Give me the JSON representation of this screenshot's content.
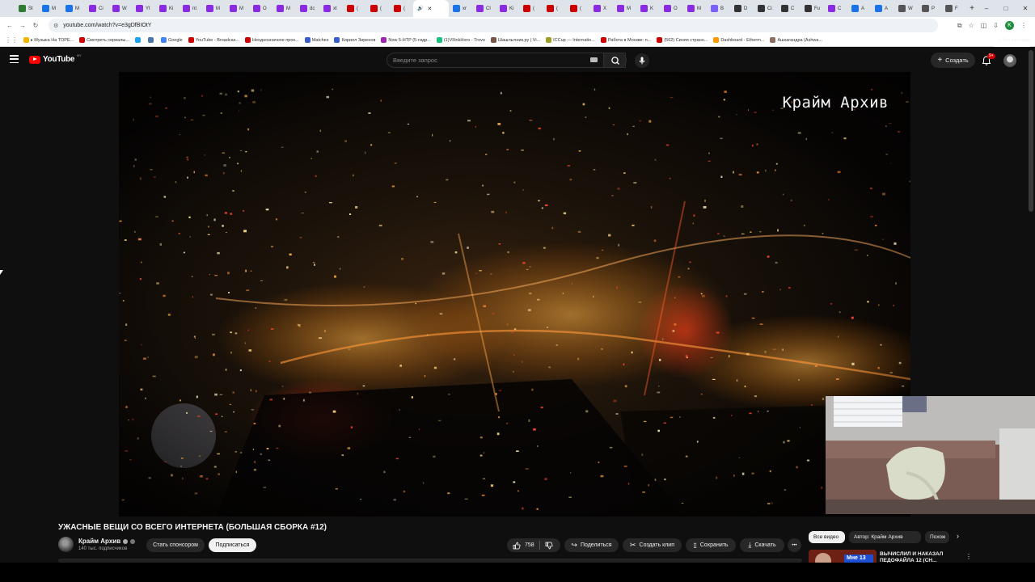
{
  "browser": {
    "tab_count_label": "",
    "active_tab_close": "✕",
    "new_tab": "+",
    "window_controls": {
      "minimize": "–",
      "maximize": "□",
      "close": "✕"
    },
    "tabs": [
      {
        "label": "St",
        "color": "#2e7d32"
      },
      {
        "label": "M",
        "color": "#1a73e8"
      },
      {
        "label": "M",
        "color": "#1a73e8"
      },
      {
        "label": "Ci",
        "color": "#8a2be2"
      },
      {
        "label": "W",
        "color": "#8a2be2"
      },
      {
        "label": "Yt",
        "color": "#8a2be2"
      },
      {
        "label": "Ki",
        "color": "#8a2be2"
      },
      {
        "label": "nt",
        "color": "#8a2be2"
      },
      {
        "label": "M",
        "color": "#8a2be2"
      },
      {
        "label": "M",
        "color": "#8a2be2"
      },
      {
        "label": "O",
        "color": "#8a2be2"
      },
      {
        "label": "M",
        "color": "#8a2be2"
      },
      {
        "label": "dc",
        "color": "#8a2be2"
      },
      {
        "label": "xt",
        "color": "#8a2be2"
      },
      {
        "label": "(",
        "color": "#cc0000"
      },
      {
        "label": "(",
        "color": "#cc0000"
      },
      {
        "label": "(",
        "color": "#cc0000"
      }
    ],
    "tabs_after": [
      {
        "label": "xr",
        "color": "#1a73e8"
      },
      {
        "label": "Cl",
        "color": "#8a2be2"
      },
      {
        "label": "Ki",
        "color": "#8a2be2"
      },
      {
        "label": "(",
        "color": "#cc0000"
      },
      {
        "label": "(",
        "color": "#cc0000"
      },
      {
        "label": "(",
        "color": "#cc0000"
      },
      {
        "label": "X",
        "color": "#8a2be2"
      },
      {
        "label": "M",
        "color": "#8a2be2"
      },
      {
        "label": "K",
        "color": "#8a2be2"
      },
      {
        "label": "O",
        "color": "#8a2be2"
      },
      {
        "label": "M",
        "color": "#8a2be2"
      },
      {
        "label": "B",
        "color": "#7b61ff"
      },
      {
        "label": "D",
        "color": "#333333"
      },
      {
        "label": "Ci",
        "color": "#333333"
      },
      {
        "label": "C",
        "color": "#333333"
      },
      {
        "label": "Fu",
        "color": "#333333"
      },
      {
        "label": "C",
        "color": "#8a2be2"
      },
      {
        "label": "A",
        "color": "#1a73e8"
      },
      {
        "label": "A",
        "color": "#1a73e8"
      },
      {
        "label": "W",
        "color": "#555555"
      },
      {
        "label": "P",
        "color": "#555555"
      },
      {
        "label": "F",
        "color": "#555555"
      }
    ],
    "active_tab": {
      "label": "",
      "icon": "speaker-icon"
    },
    "url": "youtube.com/watch?v=e3gDfBIOtY",
    "bookmarks": [
      {
        "label": "▸ Музыка На ТОРЕ...",
        "color": "#f4b400"
      },
      {
        "label": "Смотреть сериалы...",
        "color": "#cc0000"
      },
      {
        "label": "",
        "color": "#1da1f2"
      },
      {
        "label": "",
        "color": "#4a76a8"
      },
      {
        "label": "Google",
        "color": "#4285f4"
      },
      {
        "label": "YouTube - Broadcas...",
        "color": "#cc0000"
      },
      {
        "label": "Неоднозначное прох...",
        "color": "#cc0000"
      },
      {
        "label": "Matches",
        "color": "#3a5fcd"
      },
      {
        "label": "Кирилл Зиренов",
        "color": "#3a5fcd"
      },
      {
        "label": "Now 5-HTP (5-гидр...",
        "color": "#9c27b0"
      },
      {
        "label": "(1)VIIinkHoro - Trovo",
        "color": "#19c37d"
      },
      {
        "label": "Шашлычник.ру | Vi...",
        "color": "#795548"
      },
      {
        "label": "ICCup — Internatio...",
        "color": "#9e9d24"
      },
      {
        "label": "Работа в Москве: п...",
        "color": "#cc0000"
      },
      {
        "label": "(562) Синяя странн...",
        "color": "#cc0000"
      },
      {
        "label": "Dashboard - Etherm...",
        "color": "#ff9800"
      },
      {
        "label": "Ашхагандра (Ashwa...",
        "color": "#8d6e63"
      }
    ],
    "all_bookmarks": "Все закладки"
  },
  "youtube": {
    "logo_text": "YouTube",
    "logo_country": "BY",
    "search_placeholder": "Введите запрос",
    "create_label": "Создать",
    "notifications_badge": "9+",
    "video": {
      "watermark": "Крайм Архив",
      "title": "УЖАСНЫЕ ВЕЩИ СО ВСЕГО ИНТЕРНЕТА (БОЛЬШАЯ СБОРКА #12)"
    },
    "channel": {
      "name": "Крайм Архив",
      "subscribers": "140 тыс. подписчиков",
      "sponsor_label": "Стать спонсором",
      "subscribe_label": "Подписаться"
    },
    "actions": {
      "likes": "758",
      "share": "Поделиться",
      "clip": "Создать клип",
      "save": "Сохранить",
      "download": "Скачать",
      "more": "•••"
    },
    "chips": {
      "all": "Все видео",
      "author": "Автор: Крайм Архив",
      "similar": "Похож"
    },
    "recommendation": {
      "title": "ВЫЧИСЛИЛ И НАКАЗАЛ ПЕДОФАЙЛА 12 (СН...",
      "thumb_text": "Мне 13"
    }
  }
}
